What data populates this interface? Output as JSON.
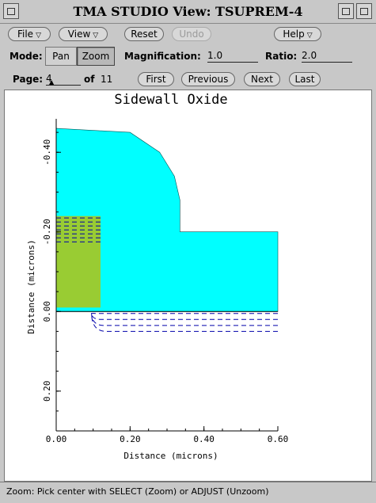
{
  "window": {
    "title": "TMA STUDIO View: TSUPREM-4"
  },
  "menus": {
    "file": "File",
    "view": "View",
    "help": "Help"
  },
  "toolbar": {
    "reset": "Reset",
    "undo": "Undo"
  },
  "mode": {
    "label": "Mode:",
    "pan": "Pan",
    "zoom": "Zoom",
    "active": "Zoom"
  },
  "magnification": {
    "label": "Magnification:",
    "value": "1.0"
  },
  "ratio": {
    "label": "Ratio:",
    "value": "2.0"
  },
  "page": {
    "label": "Page:",
    "current": "4",
    "of_label": "of",
    "total": "11",
    "first": "First",
    "previous": "Previous",
    "next": "Next",
    "last": "Last"
  },
  "plot": {
    "title": "Sidewall Oxide",
    "xlabel": "Distance (microns)",
    "ylabel": "Distance (microns)",
    "xticks": [
      "0.00",
      "0.20",
      "0.40",
      "0.60"
    ],
    "yticks": [
      "-0.40",
      "-0.20",
      "0.00",
      "0.20"
    ],
    "colors": {
      "oxide": "#00ffff",
      "poly": "#99cc33",
      "contour": "#0000aa",
      "axis": "#000000"
    }
  },
  "chart_data": {
    "type": "scatter",
    "title": "Sidewall Oxide",
    "xlabel": "Distance (microns)",
    "ylabel": "Distance (microns)",
    "xlim": [
      0.0,
      0.6
    ],
    "ylim": [
      -0.5,
      0.3
    ],
    "regions": [
      {
        "name": "oxide",
        "color": "#00ffff",
        "outline": [
          [
            0.0,
            -0.46
          ],
          [
            0.2,
            -0.45
          ],
          [
            0.28,
            -0.4
          ],
          [
            0.32,
            -0.34
          ],
          [
            0.335,
            -0.28
          ],
          [
            0.335,
            -0.2
          ],
          [
            0.6,
            -0.2
          ],
          [
            0.6,
            0.0
          ],
          [
            0.0,
            0.0
          ]
        ]
      },
      {
        "name": "polysilicon",
        "color": "#99cc33",
        "outline": [
          [
            0.0,
            -0.24
          ],
          [
            0.12,
            -0.24
          ],
          [
            0.12,
            -0.01
          ],
          [
            0.0,
            -0.01
          ]
        ]
      }
    ],
    "contours": [
      {
        "name": "poly dopant contours",
        "y": [
          -0.235,
          -0.225,
          -0.215,
          -0.205,
          -0.195,
          -0.185,
          -0.175
        ],
        "x_range": [
          0.0,
          0.12
        ]
      },
      {
        "name": "substrate dopant contours",
        "y": [
          0.005,
          0.02,
          0.035,
          0.05
        ],
        "x_range": [
          0.1,
          0.6
        ]
      }
    ]
  },
  "status": {
    "text": "Zoom: Pick center with SELECT (Zoom) or ADJUST (Unzoom)"
  }
}
